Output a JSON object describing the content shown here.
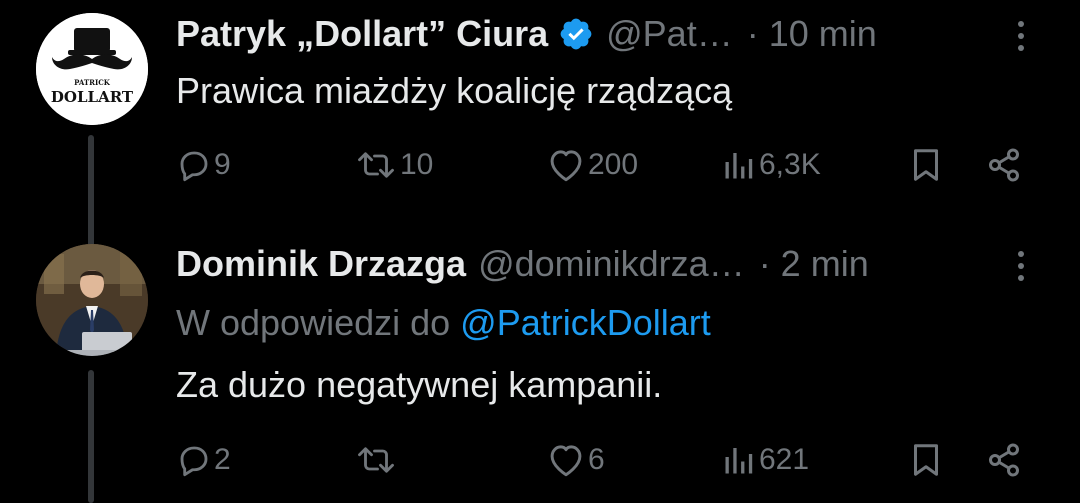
{
  "tweets": [
    {
      "author": {
        "name": "Patryk „Dollart” Ciura",
        "handle": "@Pat…",
        "verified": true,
        "avatar_line1": "PATRICK",
        "avatar_line2": "DOLLART"
      },
      "time": "· 10 min",
      "text": "Prawica miażdży koalicję rządzącą",
      "stats": {
        "replies": "9",
        "retweets": "10",
        "likes": "200",
        "views": "6,3K"
      }
    },
    {
      "author": {
        "name": "Dominik Drzazga",
        "handle": "@dominikdrza…",
        "verified": false
      },
      "time": "· 2 min",
      "reply_prefix": "W odpowiedzi do",
      "reply_mention": "@PatrickDollart",
      "text": "Za dużo negatywnej kampanii.",
      "stats": {
        "replies": "2",
        "retweets": "",
        "likes": "6",
        "views": "621"
      }
    }
  ],
  "colors": {
    "background": "#000000",
    "text": "#e7e9ea",
    "secondary": "#71767b",
    "accent": "#1d9bf0",
    "thread_line": "#333639"
  },
  "icons": [
    "reply-icon",
    "retweet-icon",
    "like-icon",
    "views-icon",
    "bookmark-icon",
    "share-icon",
    "more-icon",
    "verified-badge-icon"
  ]
}
